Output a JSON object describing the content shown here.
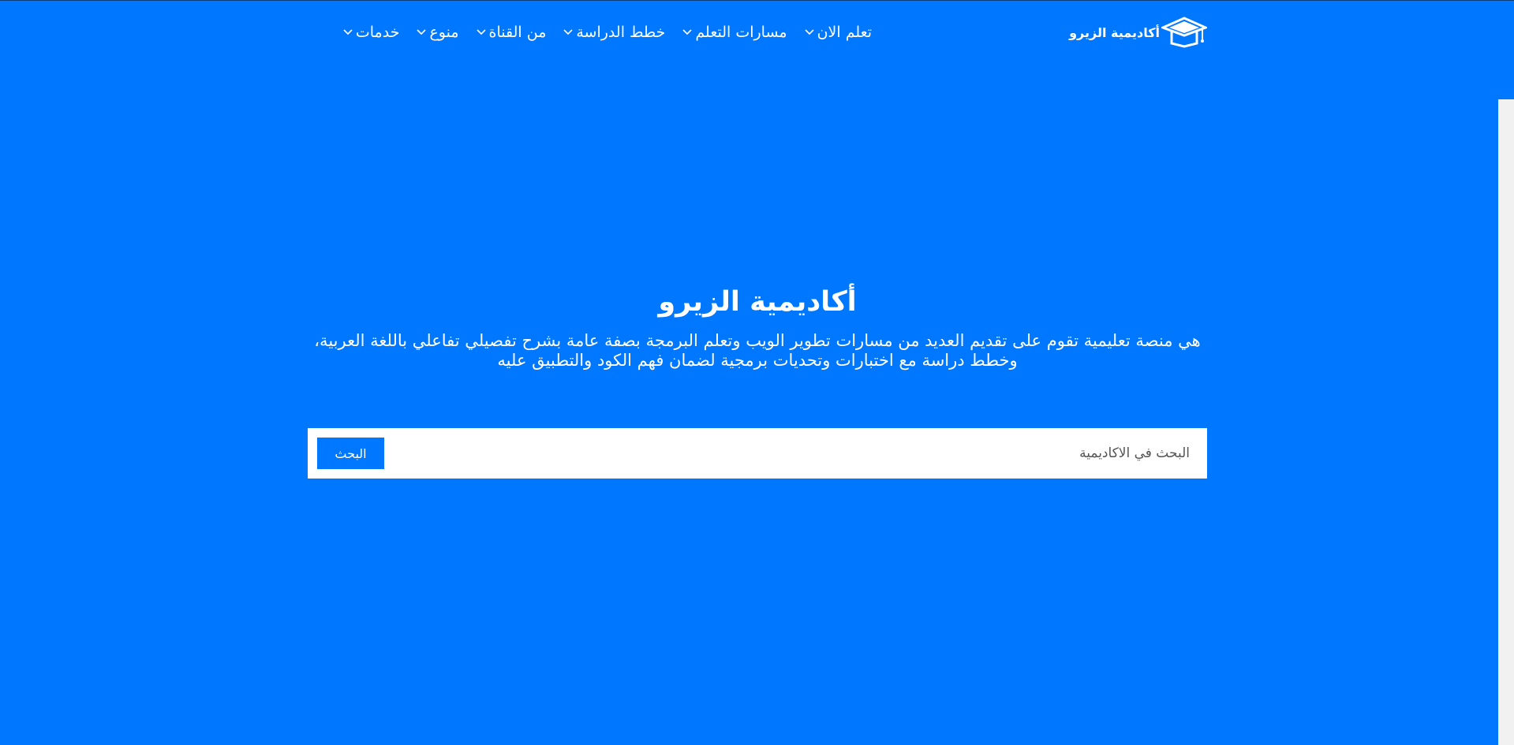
{
  "colors": {
    "background": "#0077ff",
    "accent": "#0077ff",
    "search_bg": "#ffffff",
    "text_light": "#ffffff"
  },
  "header": {
    "logo_text": "أكاديمية الزيرو",
    "logo_icon": "graduation-cap-icon",
    "nav": [
      {
        "label": "تعلم الان"
      },
      {
        "label": "مسارات التعلم"
      },
      {
        "label": "خطط الدراسة"
      },
      {
        "label": "من القناة"
      },
      {
        "label": "منوع"
      },
      {
        "label": "خدمات"
      }
    ]
  },
  "hero": {
    "title": "أكاديمية الزيرو",
    "description": "هي منصة تعليمية تقوم على تقديم العديد من مسارات تطوير الويب وتعلم البرمجة بصفة عامة بشرح تفصيلي تفاعلي باللغة العربية، وخطط دراسة مع اختبارات وتحديات برمجية لضمان فهم الكود والتطبيق عليه"
  },
  "search": {
    "placeholder": "البحث في الاكاديمية",
    "button_label": "البحث"
  }
}
